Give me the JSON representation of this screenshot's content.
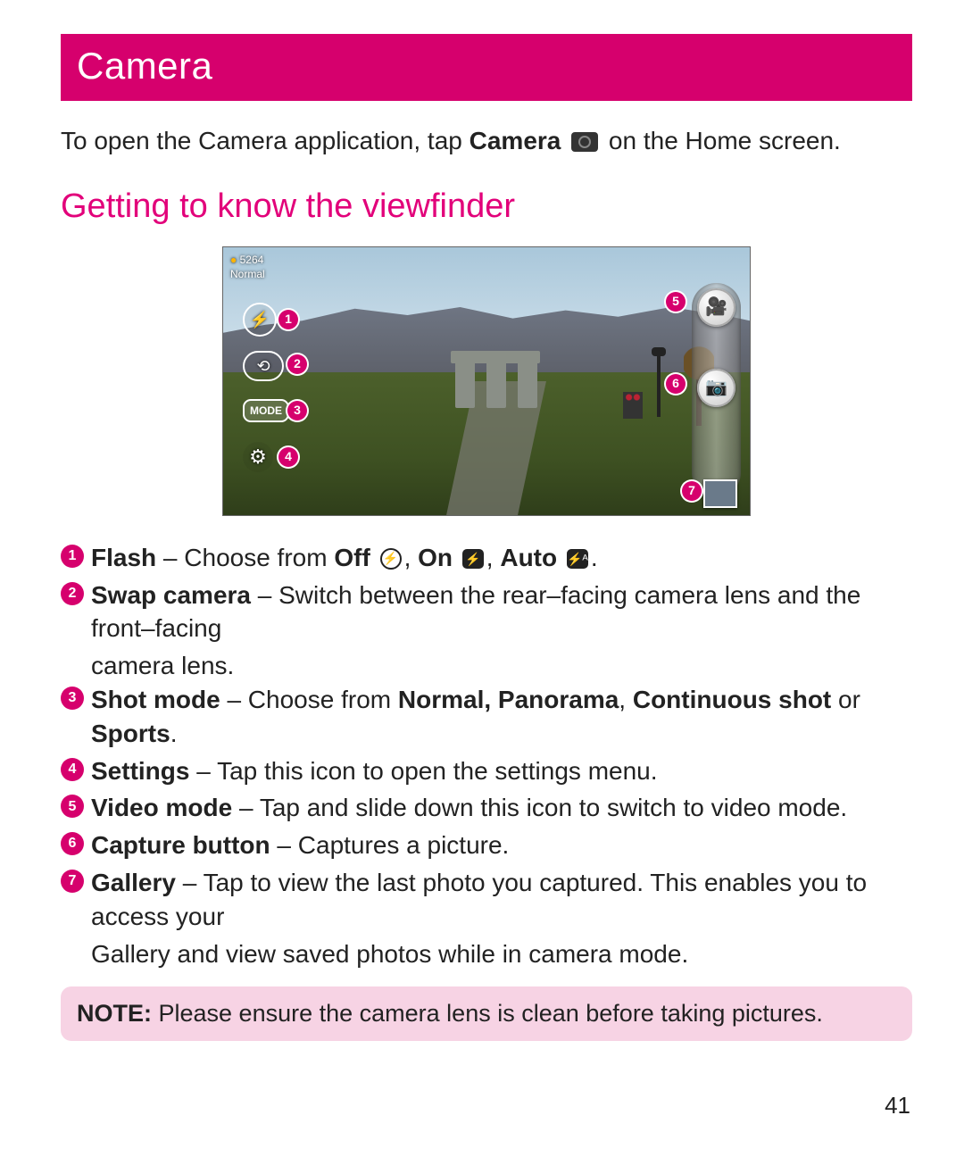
{
  "title": "Camera",
  "intro": {
    "pre": "To open the Camera application, tap ",
    "bold": "Camera",
    "post": " on the Home screen."
  },
  "section_heading": "Getting to know the viewfinder",
  "viewfinder": {
    "res": "5264",
    "mode_label": "Normal",
    "mode_button": "MODE",
    "flash_glyph": "⚡",
    "swap_glyph": "⟲",
    "settings_glyph": "⚙",
    "video_glyph": "🎥",
    "capture_glyph": "📷",
    "callouts": [
      "1",
      "2",
      "3",
      "4",
      "5",
      "6",
      "7"
    ]
  },
  "items": [
    {
      "num": "1",
      "lead": "Flash",
      "parts": [
        {
          "t": "text",
          "v": " – Choose from "
        },
        {
          "t": "bold",
          "v": "Off "
        },
        {
          "t": "icon_outline",
          "v": "⚡"
        },
        {
          "t": "text",
          "v": ", "
        },
        {
          "t": "bold",
          "v": "On "
        },
        {
          "t": "icon",
          "v": "⚡"
        },
        {
          "t": "text",
          "v": ", "
        },
        {
          "t": "bold",
          "v": "Auto "
        },
        {
          "t": "icon",
          "v": "⚡ᴬ"
        },
        {
          "t": "text",
          "v": "."
        }
      ]
    },
    {
      "num": "2",
      "lead": "Swap camera",
      "parts": [
        {
          "t": "text",
          "v": " – Switch between the rear–facing camera lens and the front–facing"
        }
      ],
      "sub": "camera lens."
    },
    {
      "num": "3",
      "lead": "Shot mode",
      "parts": [
        {
          "t": "text",
          "v": " – Choose from "
        },
        {
          "t": "bold",
          "v": "Normal, Panorama"
        },
        {
          "t": "text",
          "v": ", "
        },
        {
          "t": "bold",
          "v": "Continuous shot"
        },
        {
          "t": "text",
          "v": " or "
        },
        {
          "t": "bold",
          "v": "Sports"
        },
        {
          "t": "text",
          "v": "."
        }
      ]
    },
    {
      "num": "4",
      "lead": "Settings",
      "parts": [
        {
          "t": "text",
          "v": " – Tap this icon to open the settings menu."
        }
      ]
    },
    {
      "num": "5",
      "lead": "Video mode",
      "parts": [
        {
          "t": "text",
          "v": " – Tap and slide down this icon to switch to video mode."
        }
      ]
    },
    {
      "num": "6",
      "lead": "Capture button",
      "parts": [
        {
          "t": "text",
          "v": " – Captures a picture."
        }
      ]
    },
    {
      "num": "7",
      "lead": "Gallery",
      "parts": [
        {
          "t": "text",
          "v": " – Tap to view the last photo you captured. This enables you to access your"
        }
      ],
      "sub": "Gallery and view saved photos while in camera mode."
    }
  ],
  "note": {
    "bold": "NOTE:",
    "text": " Please ensure the camera lens is clean before taking pictures."
  },
  "page_number": "41"
}
